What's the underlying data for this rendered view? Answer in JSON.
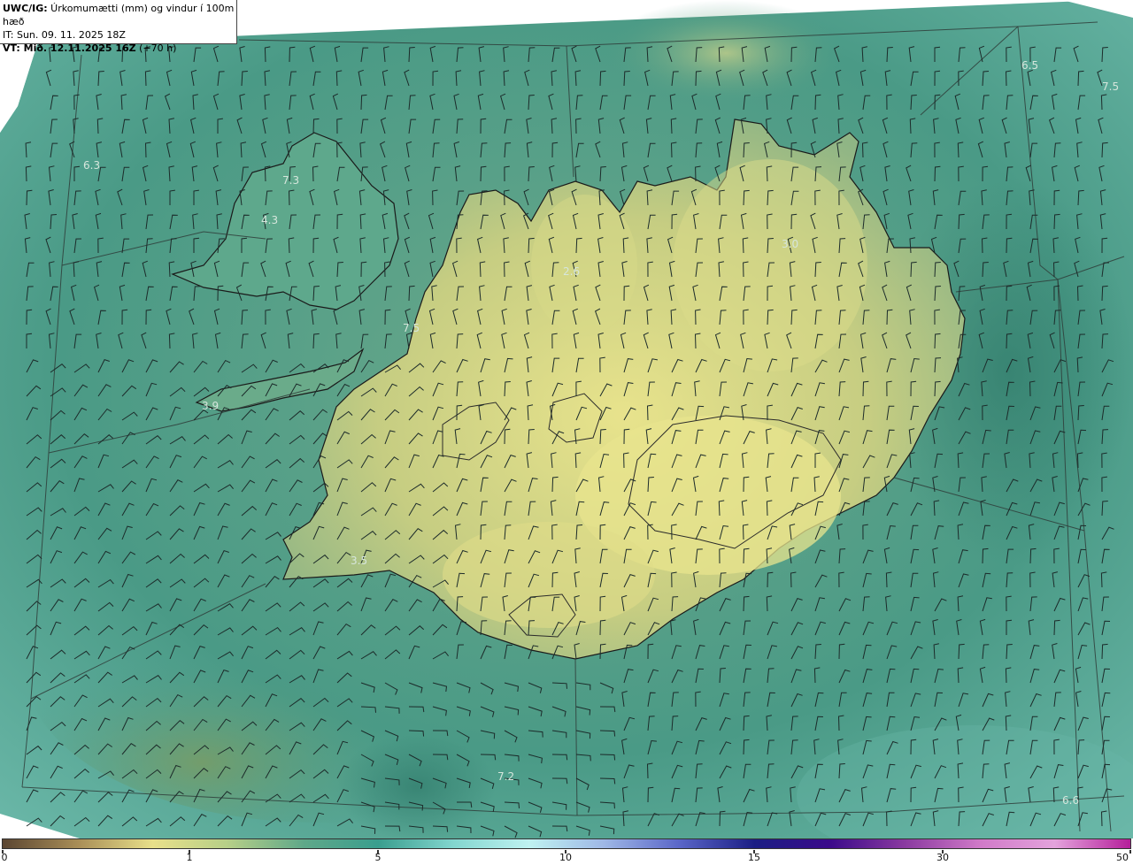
{
  "header": {
    "line1_bold": "UWC/IG:",
    "line1_text": " Úrkomumætti (mm) og vindur í 100m hæð",
    "line2": "IT: Sun. 09. 11. 2025 18Z",
    "line3_bold": "VT: Mið. 12.11.2025 16Z",
    "line3_text": " (+70 h)"
  },
  "value_labels": [
    {
      "id": "v1",
      "text": "6.3"
    },
    {
      "id": "v2",
      "text": "7.3"
    },
    {
      "id": "v3",
      "text": "4.3"
    },
    {
      "id": "v4",
      "text": "2.6"
    },
    {
      "id": "v5",
      "text": "3.0"
    },
    {
      "id": "v6",
      "text": "7.5"
    },
    {
      "id": "v7",
      "text": "3.9"
    },
    {
      "id": "v8",
      "text": "3.5"
    },
    {
      "id": "v9",
      "text": "7.2"
    },
    {
      "id": "v10",
      "text": "6.6"
    },
    {
      "id": "v11",
      "text": "6.5"
    },
    {
      "id": "v12",
      "text": "7.5"
    }
  ],
  "colorbar": {
    "ticks": [
      "0",
      "1",
      "5",
      "10",
      "15",
      "30",
      "50"
    ],
    "colors": [
      "#5b4632",
      "#a98e57",
      "#e8e08a",
      "#b6cf88",
      "#5fa889",
      "#3a9e8e",
      "#83d6cf",
      "#bff2f1",
      "#9fb8e6",
      "#5a66c8",
      "#1b1e84",
      "#3a0a8a",
      "#8a3aa0",
      "#d07ac8",
      "#e3a3dc",
      "#b51e9a"
    ]
  },
  "map": {
    "ocean_color": "#4a9a86",
    "land_low_color": "#c9cf83",
    "land_high_color": "#e9e48d"
  }
}
